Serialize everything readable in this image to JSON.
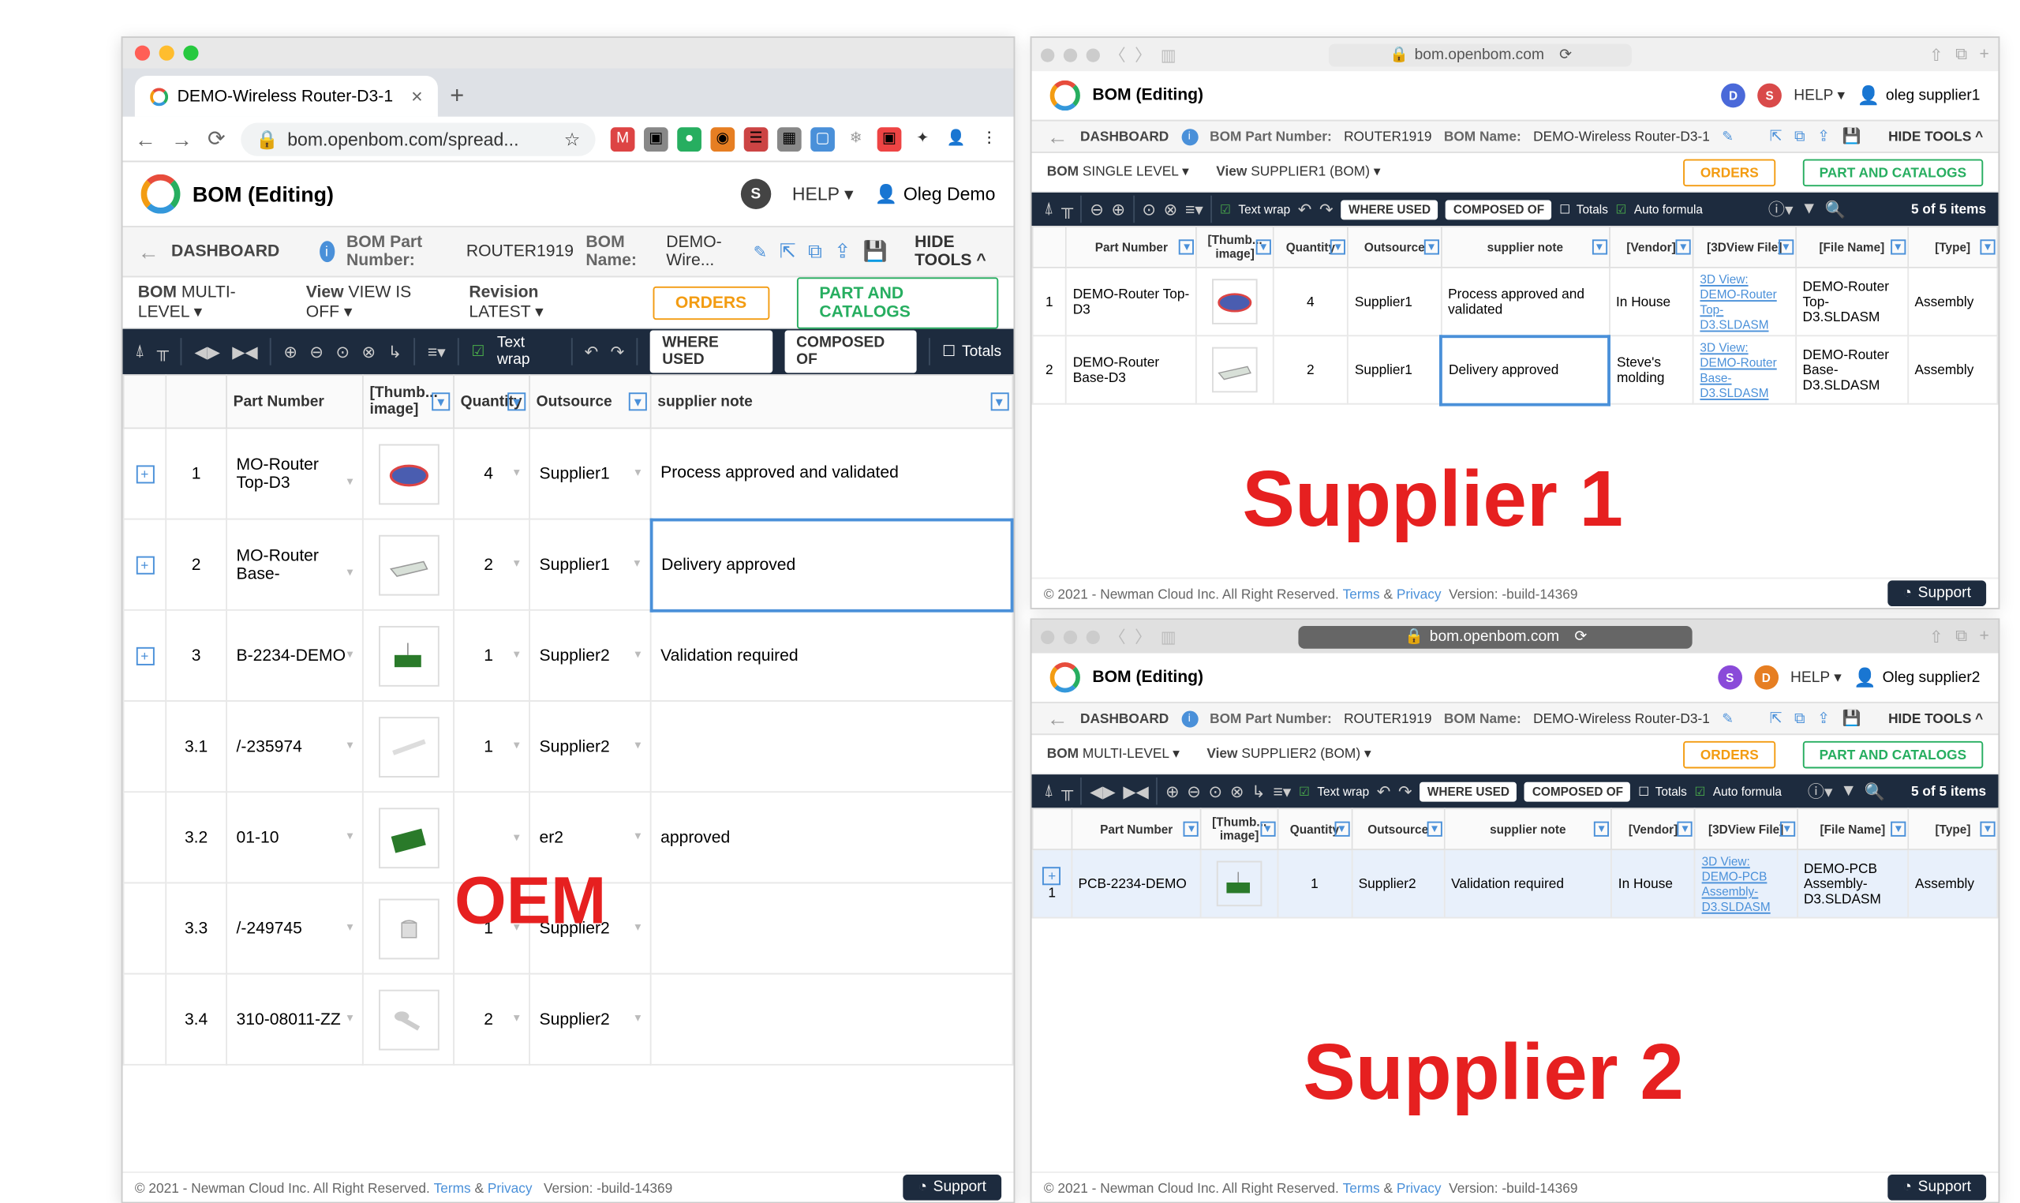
{
  "oem": {
    "browser_tab": "DEMO-Wireless Router-D3-1",
    "url_host": "bom.openbom.com/spread...",
    "app_title": "BOM (Editing)",
    "help": "HELP",
    "user": "Oleg Demo",
    "dashboard": "DASHBOARD",
    "part_num_label": "BOM Part Number:",
    "part_num": "ROUTER1919",
    "name_label": "BOM Name:",
    "name_val": "DEMO-Wire...",
    "hide_tools": "HIDE TOOLS",
    "view_bom_lbl": "BOM",
    "view_bom_val": "MULTI-LEVEL",
    "view_lbl": "View",
    "view_val": "VIEW IS OFF",
    "rev_lbl": "Revision",
    "rev_val": "LATEST",
    "orders": "ORDERS",
    "catalogs": "PART AND CATALOGS",
    "text_wrap": "Text wrap",
    "where_used": "WHERE USED",
    "composed_of": "COMPOSED OF",
    "totals": "Totals",
    "columns": {
      "part": "Part Number",
      "thumb": "[Thumb... image]",
      "qty": "Quantity",
      "out": "Outsource",
      "note": "supplier note"
    },
    "rows": [
      {
        "idx": "1",
        "expand": true,
        "part": "MO-Router Top-D3",
        "qty": "4",
        "out": "Supplier1",
        "note": "Process approved and validated",
        "thumb": "top"
      },
      {
        "idx": "2",
        "expand": true,
        "part": "MO-Router Base-",
        "qty": "2",
        "out": "Supplier1",
        "note": "Delivery approved",
        "thumb": "base",
        "selected": true
      },
      {
        "idx": "3",
        "expand": true,
        "part": "B-2234-DEMO",
        "qty": "1",
        "out": "Supplier2",
        "note": "Validation required",
        "thumb": "pcb"
      },
      {
        "idx": "3.1",
        "part": "/-235974",
        "qty": "1",
        "out": "Supplier2",
        "note": "",
        "thumb": "pen"
      },
      {
        "idx": "3.2",
        "part": "01-10",
        "qty": "",
        "out": "er2",
        "note": "approved",
        "thumb": "pcb2"
      },
      {
        "idx": "3.3",
        "part": "/-249745",
        "qty": "1",
        "out": "Supplier2",
        "note": "",
        "thumb": "cap"
      },
      {
        "idx": "3.4",
        "part": "310-08011-ZZ",
        "qty": "2",
        "out": "Supplier2",
        "note": "",
        "thumb": "screw"
      }
    ],
    "footer_copy": "© 2021 - Newman Cloud Inc. All Right Reserved.",
    "footer_terms": "Terms",
    "footer_and": "&",
    "footer_privacy": "Privacy",
    "footer_ver": "Version: -build-14369",
    "support": "Support"
  },
  "supplier1": {
    "url": "bom.openbom.com",
    "app_title": "BOM (Editing)",
    "help": "HELP",
    "user": "oleg supplier1",
    "dashboard": "DASHBOARD",
    "part_num_label": "BOM Part Number:",
    "part_num": "ROUTER1919",
    "name_label": "BOM Name:",
    "name_val": "DEMO-Wireless Router-D3-1",
    "hide_tools": "HIDE TOOLS",
    "view_bom_lbl": "BOM",
    "view_bom_val": "SINGLE LEVEL",
    "view_lbl": "View",
    "view_val": "SUPPLIER1 (BOM)",
    "orders": "ORDERS",
    "catalogs": "PART AND CATALOGS",
    "text_wrap": "Text wrap",
    "where_used": "WHERE USED",
    "composed_of": "COMPOSED OF",
    "totals": "Totals",
    "auto": "Auto formula",
    "count": "5 of 5 items",
    "columns": {
      "part": "Part Number",
      "thumb": "[Thumb... image]",
      "qty": "Quantity",
      "out": "Outsource",
      "note": "supplier note",
      "vendor": "[Vendor]",
      "file3d": "[3DView File]",
      "filename": "[File Name]",
      "type": "[Type]"
    },
    "rows": [
      {
        "idx": "1",
        "part": "DEMO-Router Top-D3",
        "qty": "4",
        "out": "Supplier1",
        "note": "Process approved and validated",
        "vendor": "In House",
        "link": "3D View: DEMO-Router Top-D3.SLDASM",
        "fname": "DEMO-Router Top-D3.SLDASM",
        "type": "Assembly",
        "thumb": "top"
      },
      {
        "idx": "2",
        "part": "DEMO-Router Base-D3",
        "qty": "2",
        "out": "Supplier1",
        "note": "Delivery approved",
        "vendor": "Steve's molding",
        "link": "3D View: DEMO-Router Base-D3.SLDASM",
        "fname": "DEMO-Router Base-D3.SLDASM",
        "type": "Assembly",
        "thumb": "base",
        "selected": true
      }
    ],
    "footer_copy": "© 2021 - Newman Cloud Inc. All Right Reserved.",
    "support": "Support"
  },
  "supplier2": {
    "url": "bom.openbom.com",
    "app_title": "BOM (Editing)",
    "help": "HELP",
    "user": "Oleg supplier2",
    "dashboard": "DASHBOARD",
    "part_num_label": "BOM Part Number:",
    "part_num": "ROUTER1919",
    "name_label": "BOM Name:",
    "name_val": "DEMO-Wireless Router-D3-1",
    "hide_tools": "HIDE TOOLS",
    "view_bom_lbl": "BOM",
    "view_bom_val": "MULTI-LEVEL",
    "view_lbl": "View",
    "view_val": "SUPPLIER2 (BOM)",
    "orders": "ORDERS",
    "catalogs": "PART AND CATALOGS",
    "text_wrap": "Text wrap",
    "where_used": "WHERE USED",
    "composed_of": "COMPOSED OF",
    "totals": "Totals",
    "auto": "Auto formula",
    "count": "5 of 5 items",
    "columns": {
      "part": "Part Number",
      "thumb": "[Thumb... image]",
      "qty": "Quantity",
      "out": "Outsource",
      "note": "supplier note",
      "vendor": "[Vendor]",
      "file3d": "[3DView File]",
      "filename": "[File Name]",
      "type": "[Type]"
    },
    "rows": [
      {
        "idx": "1",
        "part": "PCB-2234-DEMO",
        "qty": "1",
        "out": "Supplier2",
        "note": "Validation required",
        "vendor": "In House",
        "link": "3D View: DEMO-PCB Assembly-D3.SLDASM",
        "fname": "DEMO-PCB Assembly-D3.SLDASM",
        "type": "Assembly",
        "thumb": "pcb",
        "rowsel": true
      }
    ],
    "footer_copy": "© 2021 - Newman Cloud Inc. All Right Reserved.",
    "support": "Support"
  },
  "labels": {
    "oem": "OEM",
    "sup1": "Supplier 1",
    "sup2": "Supplier 2"
  }
}
